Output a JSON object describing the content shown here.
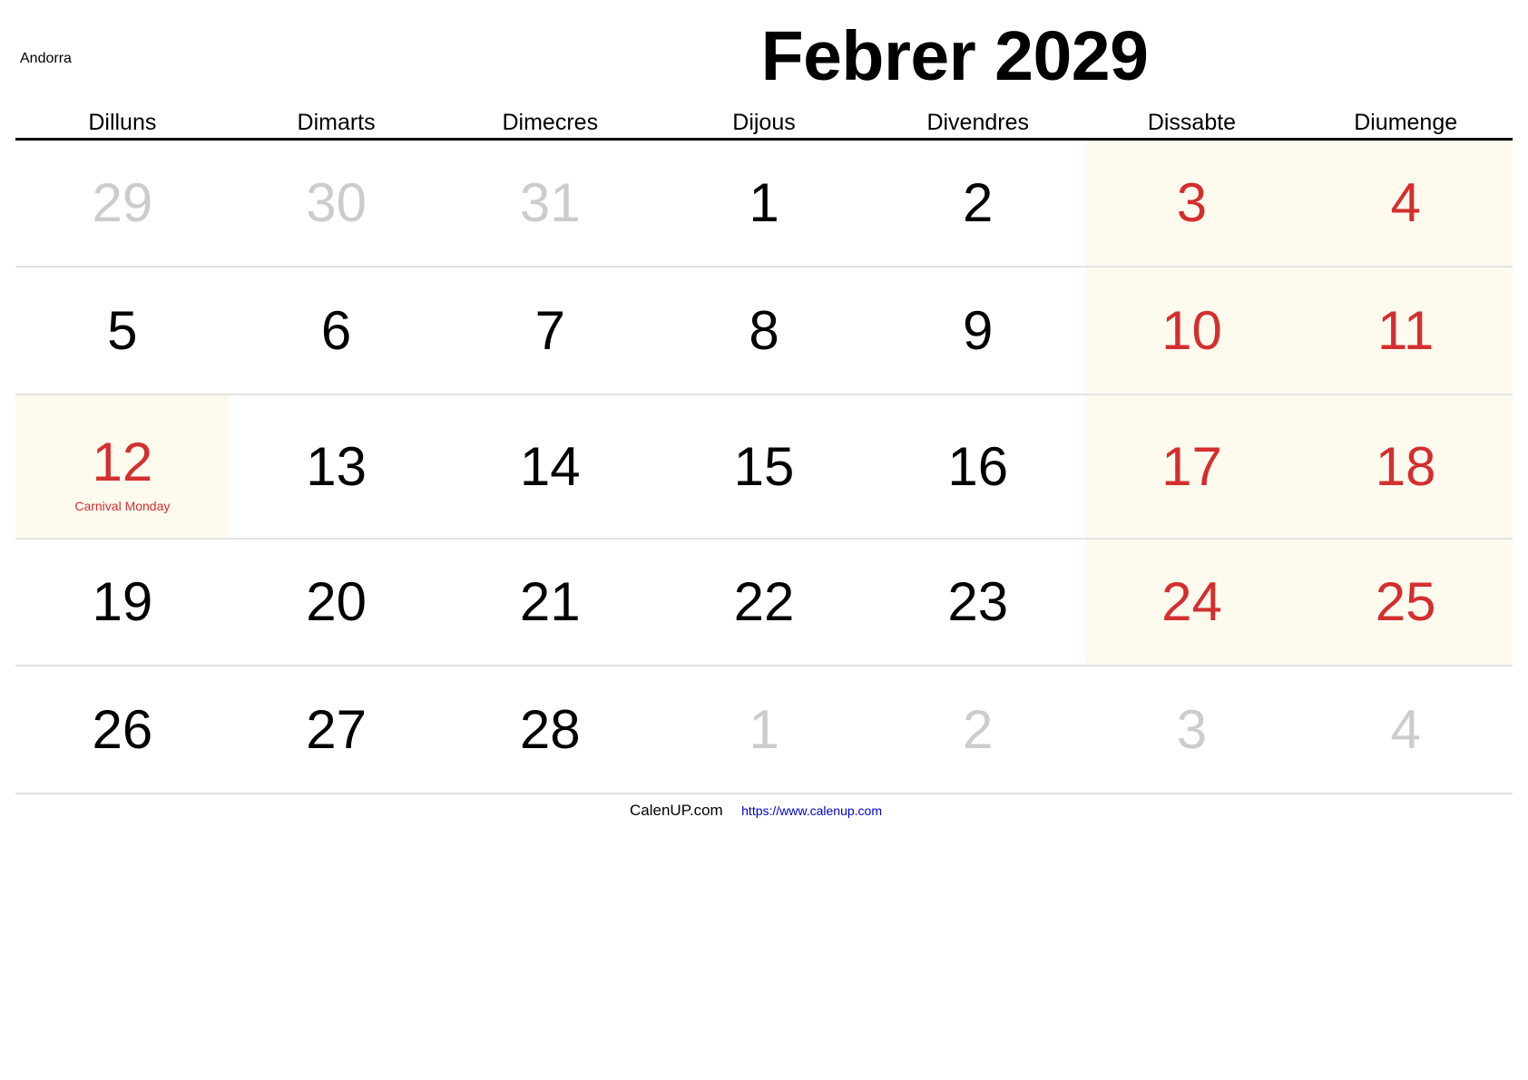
{
  "region": "Andorra",
  "title": "Febrer 2029",
  "weekdays": [
    "Dilluns",
    "Dimarts",
    "Dimecres",
    "Dijous",
    "Divendres",
    "Dissabte",
    "Diumenge"
  ],
  "weeks": [
    [
      {
        "day": "29",
        "type": "other"
      },
      {
        "day": "30",
        "type": "other"
      },
      {
        "day": "31",
        "type": "other"
      },
      {
        "day": "1",
        "type": "normal"
      },
      {
        "day": "2",
        "type": "normal"
      },
      {
        "day": "3",
        "type": "weekend"
      },
      {
        "day": "4",
        "type": "weekend"
      }
    ],
    [
      {
        "day": "5",
        "type": "normal"
      },
      {
        "day": "6",
        "type": "normal"
      },
      {
        "day": "7",
        "type": "normal"
      },
      {
        "day": "8",
        "type": "normal"
      },
      {
        "day": "9",
        "type": "normal"
      },
      {
        "day": "10",
        "type": "weekend"
      },
      {
        "day": "11",
        "type": "weekend"
      }
    ],
    [
      {
        "day": "12",
        "type": "holiday",
        "label": "Carnival Monday"
      },
      {
        "day": "13",
        "type": "normal"
      },
      {
        "day": "14",
        "type": "normal"
      },
      {
        "day": "15",
        "type": "normal"
      },
      {
        "day": "16",
        "type": "normal"
      },
      {
        "day": "17",
        "type": "weekend"
      },
      {
        "day": "18",
        "type": "weekend"
      }
    ],
    [
      {
        "day": "19",
        "type": "normal"
      },
      {
        "day": "20",
        "type": "normal"
      },
      {
        "day": "21",
        "type": "normal"
      },
      {
        "day": "22",
        "type": "normal"
      },
      {
        "day": "23",
        "type": "normal"
      },
      {
        "day": "24",
        "type": "weekend"
      },
      {
        "day": "25",
        "type": "weekend"
      }
    ],
    [
      {
        "day": "26",
        "type": "normal"
      },
      {
        "day": "27",
        "type": "normal"
      },
      {
        "day": "28",
        "type": "normal"
      },
      {
        "day": "1",
        "type": "other"
      },
      {
        "day": "2",
        "type": "other"
      },
      {
        "day": "3",
        "type": "other"
      },
      {
        "day": "4",
        "type": "other"
      }
    ]
  ],
  "footer": {
    "brand": "CalenUP.com",
    "link": "https://www.calenup.com"
  },
  "colors": {
    "weekend_text": "#d32f2f",
    "weekend_bg": "#fffaee",
    "other_month_text": "#cccccc",
    "link": "#0000cc"
  }
}
